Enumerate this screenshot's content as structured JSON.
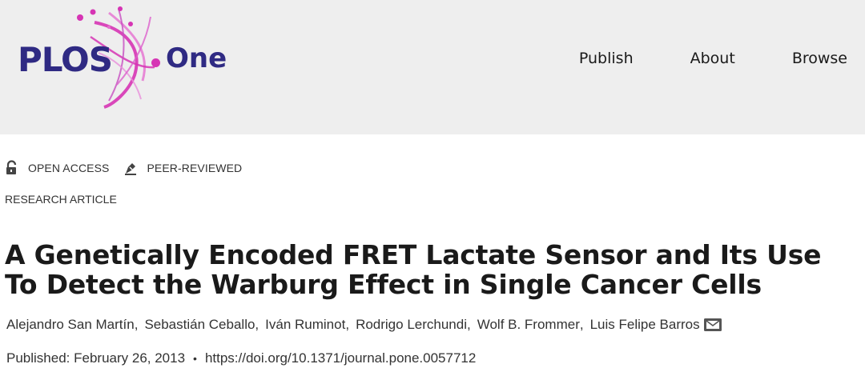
{
  "brand": {
    "logo_word": "PLOS",
    "logo_suffix": "One",
    "colors": {
      "navy": "#2f2a83",
      "magenta": "#d634b4",
      "header_bg": "#eeeeee"
    }
  },
  "nav": {
    "items": [
      {
        "label": "Publish"
      },
      {
        "label": "About"
      },
      {
        "label": "Browse"
      }
    ]
  },
  "badges": {
    "open_access": {
      "label": "OPEN ACCESS",
      "icon": "unlock-icon"
    },
    "peer_reviewed": {
      "label": "PEER-REVIEWED",
      "icon": "pen-icon"
    }
  },
  "article": {
    "type": "RESEARCH ARTICLE",
    "title": "A Genetically Encoded FRET Lactate Sensor and Its Use To Detect the Warburg Effect in Single Cancer Cells",
    "authors": [
      "Alejandro San Martín",
      "Sebastián Ceballo",
      "Iván Ruminot",
      "Rodrigo Lerchundi",
      "Wolf B. Frommer",
      "Luis Felipe Barros"
    ],
    "separator": ",",
    "corresponding_icon": "mail-icon",
    "published": "Published: February 26, 2013",
    "bullet": "•",
    "doi": "https://doi.org/10.1371/journal.pone.0057712"
  }
}
